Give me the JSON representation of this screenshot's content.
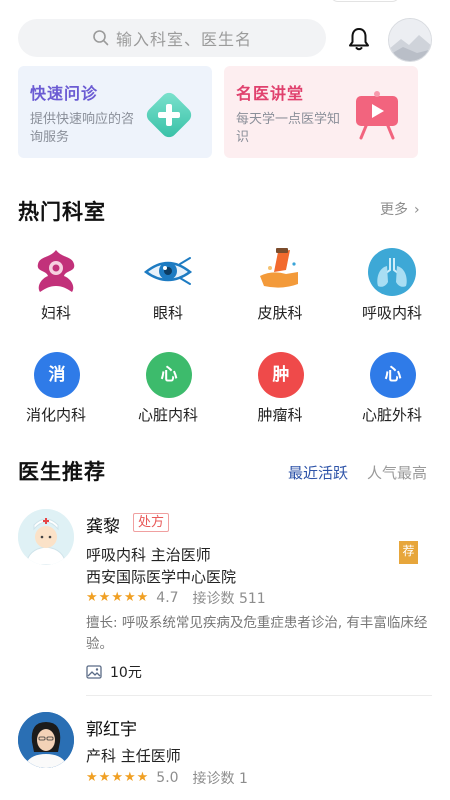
{
  "search": {
    "placeholder": "输入科室、医生名"
  },
  "promos": [
    {
      "title": "快速问诊",
      "desc": "提供快速响应的咨询服务"
    },
    {
      "title": "名医讲堂",
      "desc": "每天学一点医学知识"
    }
  ],
  "departments": {
    "title": "热门科室",
    "more_label": "更多",
    "items": [
      {
        "label": "妇科",
        "icon": "gynecology-icon"
      },
      {
        "label": "眼科",
        "icon": "eye-icon"
      },
      {
        "label": "皮肤科",
        "icon": "dermatology-icon"
      },
      {
        "label": "呼吸内科",
        "icon": "lungs-icon"
      },
      {
        "label": "消化内科",
        "glyph": "消",
        "color": "#2f7be8"
      },
      {
        "label": "心脏内科",
        "glyph": "心",
        "color": "#3dbb6c"
      },
      {
        "label": "肿瘤科",
        "glyph": "肿",
        "color": "#ef4a4a"
      },
      {
        "label": "心脏外科",
        "glyph": "心",
        "color": "#2f7be8"
      }
    ]
  },
  "doctors": {
    "title": "医生推荐",
    "tabs": [
      "最近活跃",
      "人气最高"
    ],
    "items": [
      {
        "name": "龚黎",
        "tag": "处方",
        "dept_title": "呼吸内科  主治医师",
        "hospital": "西安国际医学中心医院",
        "score": "4.7",
        "consults": "接诊数 511",
        "expertise": "擅长: 呼吸系统常见疾病及危重症患者诊治, 有丰富临床经验。",
        "fee": "10元",
        "badge": "荐"
      },
      {
        "name": "郭红宇",
        "dept_title": "产科  主任医师",
        "score": "5.0",
        "consults": "接诊数 1"
      }
    ]
  },
  "colors": {
    "accent_blue": "#2d53a8",
    "star": "#f0a024"
  }
}
